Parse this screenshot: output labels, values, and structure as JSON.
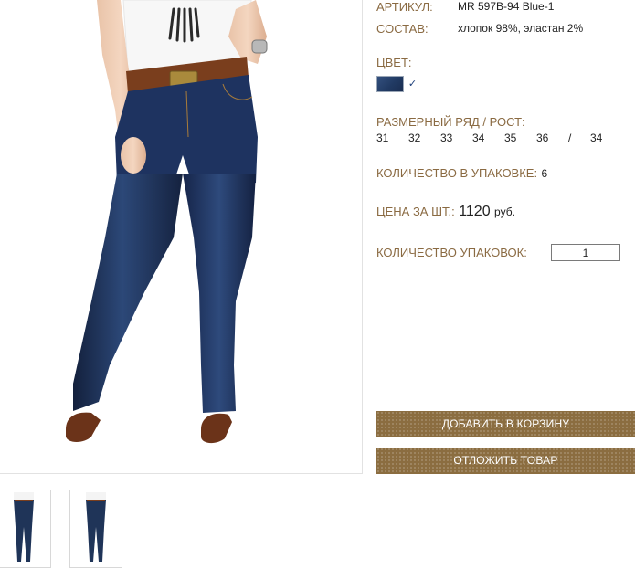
{
  "product": {
    "article_label": "АРТИКУЛ:",
    "article_value": "MR 597B-94 Blue-1",
    "composition_label": "СОСТАВ:",
    "composition_value": "хлопок 98%, эластан 2%",
    "color_label": "ЦВЕТ:",
    "color_swatch": "#2a4470",
    "color_checked_glyph": "✓",
    "size_label": "РАЗМЕРНЫЙ РЯД / РОСТ:",
    "sizes": [
      "31",
      "32",
      "33",
      "34",
      "35",
      "36",
      "/",
      "34"
    ],
    "pack_qty_label": "КОЛИЧЕСТВО В УПАКОВКЕ:",
    "pack_qty_value": "6",
    "price_label": "ЦЕНА ЗА ШТ.:",
    "price_value": "1120",
    "price_currency": "руб.",
    "packs_label": "КОЛИЧЕСТВО УПАКОВОК:",
    "packs_value": "1"
  },
  "buttons": {
    "add_to_cart": "ДОБАВИТЬ В КОРЗИНУ",
    "postpone": "ОТЛОЖИТЬ ТОВАР"
  },
  "colors": {
    "label": "#8a6a42",
    "button": "#8b6d40",
    "denim": "#1f3458"
  }
}
